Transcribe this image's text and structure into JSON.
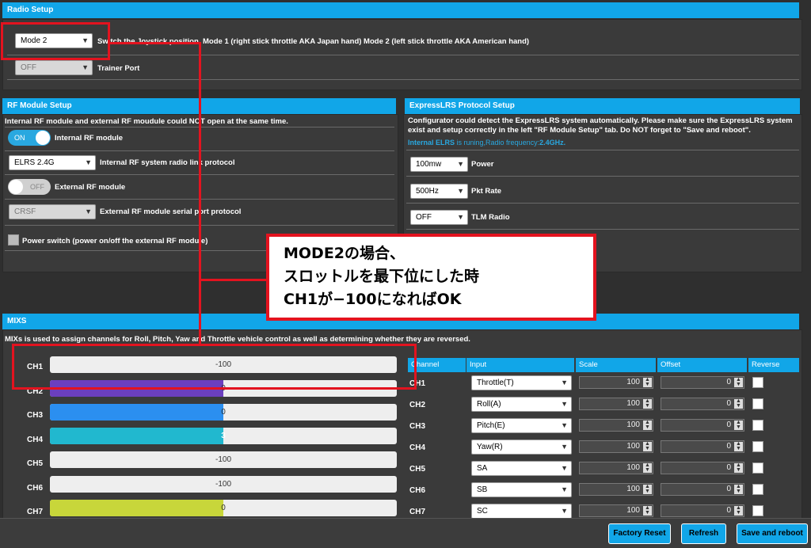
{
  "radio_setup": {
    "title": "Radio Setup",
    "mode_value": "Mode 2",
    "mode_desc": "Switch the Joystick position. Mode 1 (right stick throttle AKA Japan hand) Mode 2 (left stick throttle AKA American hand)",
    "trainer_value": "OFF",
    "trainer_label": "Trainer Port"
  },
  "rf_module": {
    "title": "RF Module Setup",
    "note": "Internal RF module and external RF moudule could NOT open at the same time.",
    "internal_toggle": "ON",
    "internal_label": "Internal RF module",
    "protocol_value": "ELRS 2.4G",
    "protocol_label": "Internal RF system radio link protocol",
    "external_toggle": "OFF",
    "external_label": "External RF module",
    "serial_value": "CRSF",
    "serial_label": "External RF module serial port protocol",
    "power_switch_label": "Power switch (power on/off the external RF module)"
  },
  "elrs": {
    "title": "ExpressLRS Protocol Setup",
    "desc": "Configurator could detect the ExpressLRS system automatically. Please make sure the ExpressLRS system exist and setup correctly in the left \"RF Module Setup\" tab. Do NOT forget to \"Save and reboot\".",
    "status_prefix": "Internal ELRS",
    "status_mid": " is runing,Radio frequency:",
    "status_freq": "2.4GHz.",
    "power_value": "100mw",
    "power_label": "Power",
    "rate_value": "500Hz",
    "rate_label": "Pkt Rate",
    "tlm_value": "OFF",
    "tlm_label": "TLM Radio"
  },
  "annotation": {
    "line1": "MODE2の場合、",
    "line2": "スロットルを最下位にした時",
    "line3": "CH1が−100になればOK"
  },
  "mixs": {
    "title": "MIXS",
    "desc": "MIXs is used to assign channels for Roll, Pitch, Yaw and Throttle vehicle control as well as determining whether they are reversed.",
    "channels": [
      {
        "name": "CH1",
        "value": "-100",
        "fill": 0,
        "color": "#eeeeee"
      },
      {
        "name": "CH2",
        "value": "0",
        "fill": 0.5,
        "color": "#6b3fbf"
      },
      {
        "name": "CH3",
        "value": "0",
        "fill": 0.5,
        "color": "#2b8ff0"
      },
      {
        "name": "CH4",
        "value": "3",
        "fill": 0.5,
        "color": "#21b8cf"
      },
      {
        "name": "CH5",
        "value": "-100",
        "fill": 0,
        "color": "#eeeeee"
      },
      {
        "name": "CH6",
        "value": "-100",
        "fill": 0,
        "color": "#eeeeee"
      },
      {
        "name": "CH7",
        "value": "0",
        "fill": 0.5,
        "color": "#c8d63a"
      }
    ],
    "table_headers": [
      "Channel",
      "Input",
      "Scale",
      "Offset",
      "Reverse"
    ],
    "rows": [
      {
        "ch": "CH1",
        "input": "Throttle(T)",
        "scale": "100",
        "offset": "0"
      },
      {
        "ch": "CH2",
        "input": "Roll(A)",
        "scale": "100",
        "offset": "0"
      },
      {
        "ch": "CH3",
        "input": "Pitch(E)",
        "scale": "100",
        "offset": "0"
      },
      {
        "ch": "CH4",
        "input": "Yaw(R)",
        "scale": "100",
        "offset": "0"
      },
      {
        "ch": "CH5",
        "input": "SA",
        "scale": "100",
        "offset": "0"
      },
      {
        "ch": "CH6",
        "input": "SB",
        "scale": "100",
        "offset": "0"
      },
      {
        "ch": "CH7",
        "input": "SC",
        "scale": "100",
        "offset": "0"
      }
    ]
  },
  "footer": {
    "factory_reset": "Factory Reset",
    "refresh": "Refresh",
    "save_reboot": "Save and reboot"
  }
}
